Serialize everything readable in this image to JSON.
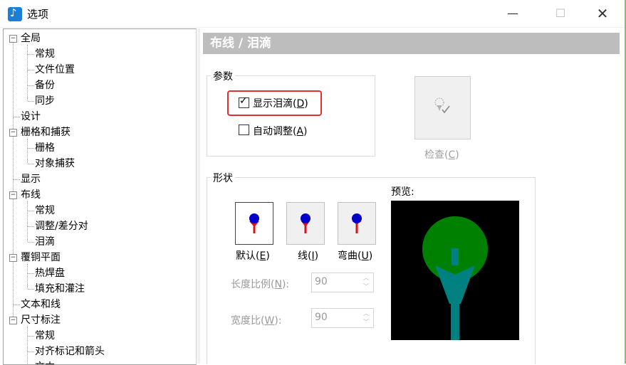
{
  "window": {
    "title": "选项",
    "minimize": "—",
    "maximize": "☐",
    "close": "✕"
  },
  "tree": {
    "items": [
      {
        "label": "全局",
        "expander": "−"
      },
      {
        "label": "常规"
      },
      {
        "label": "文件位置"
      },
      {
        "label": "备份"
      },
      {
        "label": "同步"
      },
      {
        "label": "设计"
      },
      {
        "label": "栅格和捕获",
        "expander": "−"
      },
      {
        "label": "栅格"
      },
      {
        "label": "对象捕获"
      },
      {
        "label": "显示"
      },
      {
        "label": "布线",
        "expander": "−"
      },
      {
        "label": "常规"
      },
      {
        "label": "调整/差分对"
      },
      {
        "label": "泪滴"
      },
      {
        "label": "覆铜平面",
        "expander": "−"
      },
      {
        "label": "热焊盘"
      },
      {
        "label": "填充和灌注"
      },
      {
        "label": "文本和线"
      },
      {
        "label": "尺寸标注",
        "expander": "−"
      },
      {
        "label": "常规"
      },
      {
        "label": "对齐标记和箭头"
      },
      {
        "label": "文本"
      }
    ]
  },
  "panel": {
    "header": "布线 / 泪滴",
    "params_group": {
      "label": "参数",
      "show_teardrop": {
        "label_pre": "显示泪滴(",
        "mnemonic": "D",
        "label_post": ")",
        "checked": true
      },
      "auto_adjust": {
        "label_pre": "自动调整(",
        "mnemonic": "A",
        "label_post": ")",
        "checked": false
      }
    },
    "check_button": {
      "label_pre": "检查(",
      "mnemonic": "C",
      "label_post": ")",
      "icon": "teardrop-check-icon"
    },
    "shape_group": {
      "label": "形状",
      "buttons": [
        {
          "label_pre": "默认(",
          "mnemonic": "E",
          "label_post": ")",
          "selected": true
        },
        {
          "label_pre": "线(",
          "mnemonic": "I",
          "label_post": ")",
          "selected": false
        },
        {
          "label_pre": "弯曲(",
          "mnemonic": "U",
          "label_post": ")",
          "selected": false
        }
      ],
      "length_ratio": {
        "label_pre": "长度比例(",
        "mnemonic": "N",
        "label_post": "):",
        "value": "90"
      },
      "width_ratio": {
        "label_pre": "宽度比(",
        "mnemonic": "W",
        "label_post": "):",
        "value": "90"
      },
      "preview_label": "预览:"
    }
  },
  "colors": {
    "header_bg": "#bdbdbd",
    "highlight": "#e03131",
    "preview_pad": "#008000",
    "preview_trace": "#008080",
    "shape_pad": "#0000cc",
    "shape_trace": "#dd1111"
  }
}
